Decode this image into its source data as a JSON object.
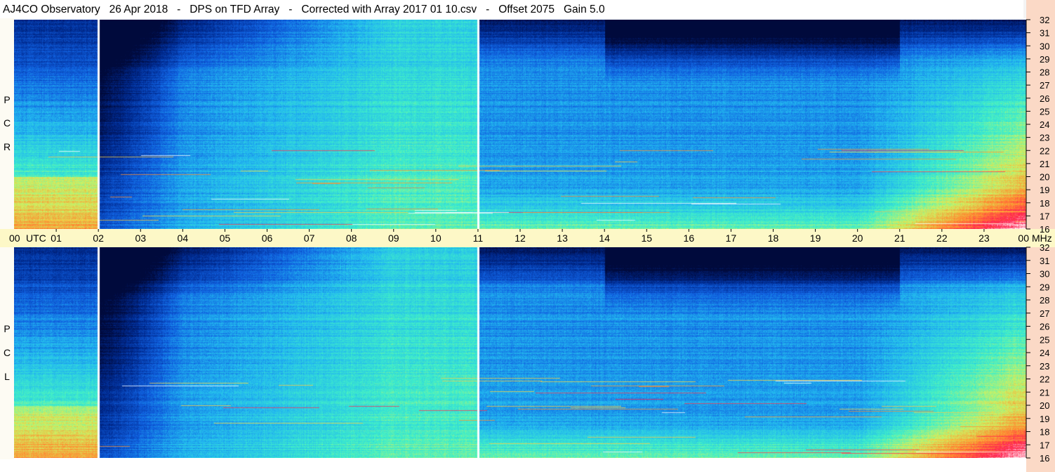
{
  "title": {
    "observatory": "AJ4CO Observatory",
    "date": "26 Apr 2018",
    "description": "DPS on TFD Array",
    "correction": "Corrected with Array 2017 01 10.csv",
    "offset": "Offset 2075",
    "gain": "Gain 5.0",
    "separator": "-"
  },
  "colors": {
    "background": "#ffffff",
    "time_axis_bg": "#fdf8c7",
    "freq_axis_bg": "#fbd9c6",
    "label_bar_bg": "#fdfbf3",
    "gap_line": "#ffffff"
  },
  "chart_data": {
    "type": "heatmap",
    "colormap": [
      "#000a3c",
      "#002a90",
      "#1060e0",
      "#22b8f0",
      "#40f0c8",
      "#d0f060",
      "#ff9030",
      "#ff2050",
      "#ffffff"
    ],
    "panels": [
      {
        "name": "RCP",
        "label_letters": [
          "R",
          "C",
          "P"
        ]
      },
      {
        "name": "LCP",
        "label_letters": [
          "L",
          "C",
          "P"
        ]
      }
    ],
    "x_axis": {
      "label": "UTC",
      "ticks": [
        "00",
        "01",
        "02",
        "03",
        "04",
        "05",
        "06",
        "07",
        "08",
        "09",
        "10",
        "11",
        "12",
        "13",
        "14",
        "15",
        "16",
        "17",
        "18",
        "19",
        "20",
        "21",
        "22",
        "23",
        "00"
      ],
      "range_hours": [
        0,
        24
      ]
    },
    "y_axis": {
      "unit": "MHz",
      "ticks": [
        32,
        31,
        30,
        29,
        28,
        27,
        26,
        25,
        24,
        23,
        22,
        21,
        20,
        19,
        18,
        17,
        16
      ],
      "range_mhz": [
        16,
        32
      ]
    },
    "data_gaps_utc": [
      2.0,
      11.0
    ]
  }
}
